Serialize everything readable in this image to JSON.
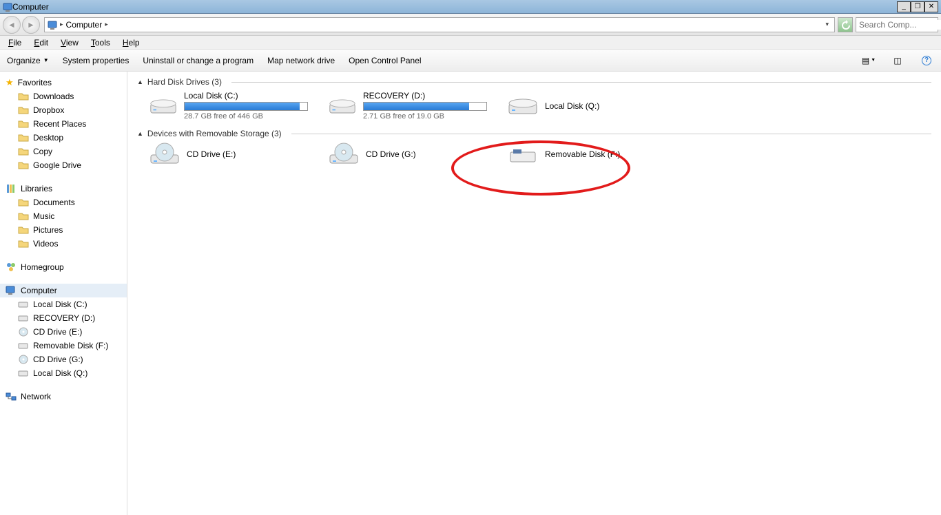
{
  "window": {
    "title": "Computer"
  },
  "address": {
    "crumb": "Computer",
    "dropdown": "▸"
  },
  "search": {
    "placeholder": "Search Comp..."
  },
  "menubar": [
    "File",
    "Edit",
    "View",
    "Tools",
    "Help"
  ],
  "toolbar": {
    "organize": "Organize",
    "items": [
      "System properties",
      "Uninstall or change a program",
      "Map network drive",
      "Open Control Panel"
    ]
  },
  "sidebar": {
    "favorites": {
      "label": "Favorites",
      "items": [
        "Downloads",
        "Dropbox",
        "Recent Places",
        "Desktop",
        "Copy",
        "Google Drive"
      ]
    },
    "libraries": {
      "label": "Libraries",
      "items": [
        "Documents",
        "Music",
        "Pictures",
        "Videos"
      ]
    },
    "homegroup": {
      "label": "Homegroup"
    },
    "computer": {
      "label": "Computer",
      "items": [
        "Local Disk (C:)",
        "RECOVERY (D:)",
        "CD Drive (E:)",
        "Removable Disk (F:)",
        "CD Drive (G:)",
        "Local Disk (Q:)"
      ]
    },
    "network": {
      "label": "Network"
    }
  },
  "sections": {
    "hdd": {
      "label": "Hard Disk Drives (3)",
      "drives": [
        {
          "name": "Local Disk (C:)",
          "free": "28.7 GB free of 446 GB",
          "fill": 94
        },
        {
          "name": "RECOVERY (D:)",
          "free": "2.71 GB free of 19.0 GB",
          "fill": 86
        },
        {
          "name": "Local Disk (Q:)",
          "free": "",
          "fill": null
        }
      ]
    },
    "removable": {
      "label": "Devices with Removable Storage (3)",
      "drives": [
        {
          "name": "CD Drive (E:)"
        },
        {
          "name": "CD Drive (G:)"
        },
        {
          "name": "Removable Disk (F:)"
        }
      ]
    }
  }
}
